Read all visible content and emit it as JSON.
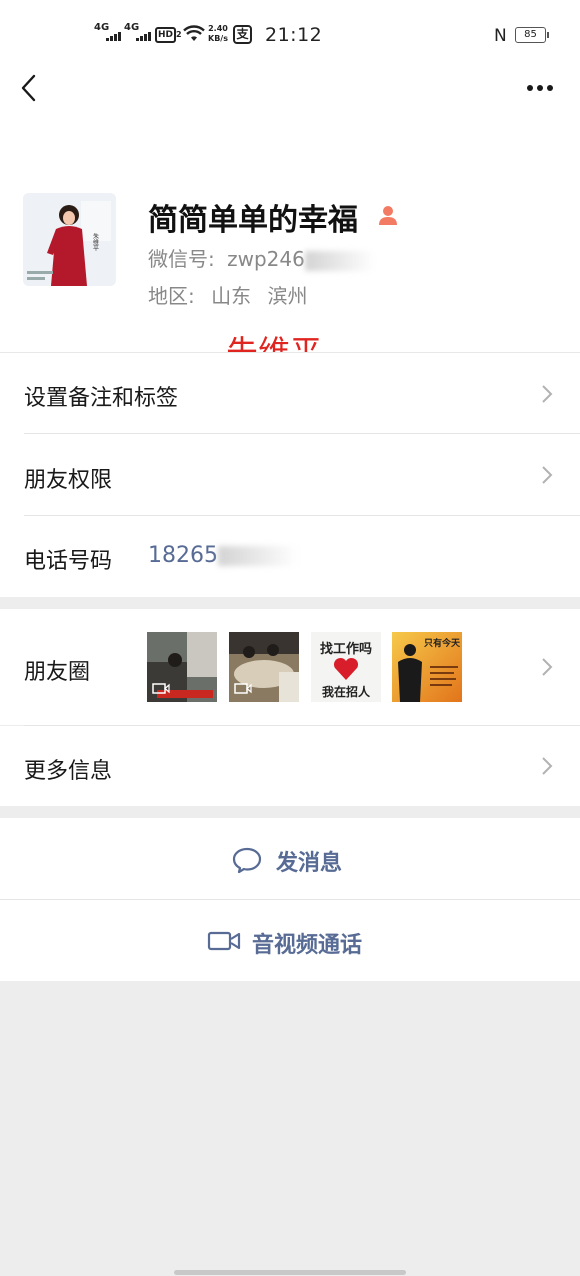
{
  "status_bar": {
    "signal1_label": "4G",
    "signal2_label": "4G",
    "hd_label": "HD",
    "hd_sub": "2",
    "speed_value": "2.40",
    "speed_unit": "KB/s",
    "alipay_glyph": "支",
    "time": "21:12",
    "nfc_glyph": "N",
    "battery": "85"
  },
  "nav": {
    "back_icon": "chevron-left-icon",
    "more_icon": "more-horizontal-icon"
  },
  "profile": {
    "nickname": "简简单单的幸福",
    "wechat_id_label": "微信号:",
    "wechat_id_value": "zwp246",
    "region_label": "地区:",
    "region_province": "山东",
    "region_city": "滨州",
    "gender_icon": "female-user-icon",
    "gender_color": "#f37b63",
    "annotation": "朱维平",
    "annotation_color": "#e0241f",
    "avatar_name_tag": "朱维平"
  },
  "rows": {
    "remarks_tags": "设置备注和标签",
    "friend_permissions": "朋友权限",
    "phone_label": "电话号码",
    "phone_value": "18265",
    "moments_label": "朋友圈",
    "more_info": "更多信息"
  },
  "moments_thumbs": [
    {
      "type": "video",
      "caption": ""
    },
    {
      "type": "video",
      "caption": ""
    },
    {
      "type": "image",
      "line1": "找工作吗",
      "line2": "我在招人"
    },
    {
      "type": "image",
      "caption": "只有今天"
    }
  ],
  "actions": {
    "send_message": "发消息",
    "video_call": "音视频通话"
  },
  "colors": {
    "link_blue": "#576b95",
    "background": "#ededed"
  }
}
